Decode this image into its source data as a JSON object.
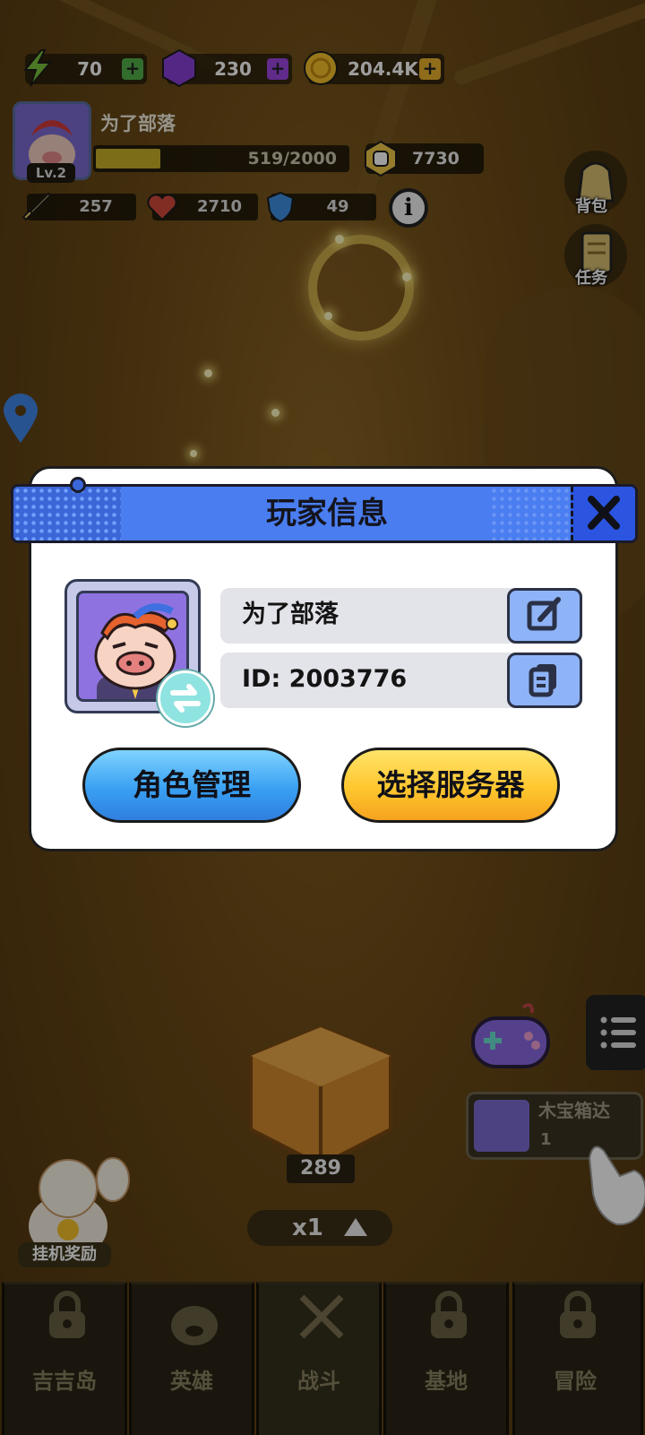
{
  "hud": {
    "energy": "70",
    "gems": "230",
    "gold": "204.4K",
    "player_name": "为了部落",
    "level": "Lv.2",
    "xp": "519/2000",
    "xp_fraction": 0.26,
    "power": "7730",
    "attack": "257",
    "hp": "2710",
    "defense": "49",
    "info": "i"
  },
  "side_buttons": {
    "bag": "背包",
    "tasks": "任务"
  },
  "dialog": {
    "title": "玩家信息",
    "name": "为了部落",
    "id_text": "ID: 2003776",
    "role_manage_label": "角色管理",
    "select_server_label": "选择服务器"
  },
  "battle": {
    "crate_count": "289",
    "speed": "x1",
    "quest_text": "木宝箱达",
    "quest_num": "1",
    "idle_reward_label": "挂机奖励"
  },
  "nav": {
    "tabs": [
      {
        "label": "吉吉岛",
        "icon": "lock-icon"
      },
      {
        "label": "英雄",
        "icon": "pig-hero-icon"
      },
      {
        "label": "战斗",
        "icon": "crossed-swords-icon"
      },
      {
        "label": "基地",
        "icon": "lock-icon"
      },
      {
        "label": "冒险",
        "icon": "lock-icon"
      }
    ]
  },
  "colors": {
    "header_blue": "#4a7df0",
    "button_blue": "#39a0f2",
    "button_yellow": "#ffc72e",
    "energy_green": "#7ac23a",
    "gem_purple": "#8a3fd6",
    "gold": "#f4c12b"
  }
}
